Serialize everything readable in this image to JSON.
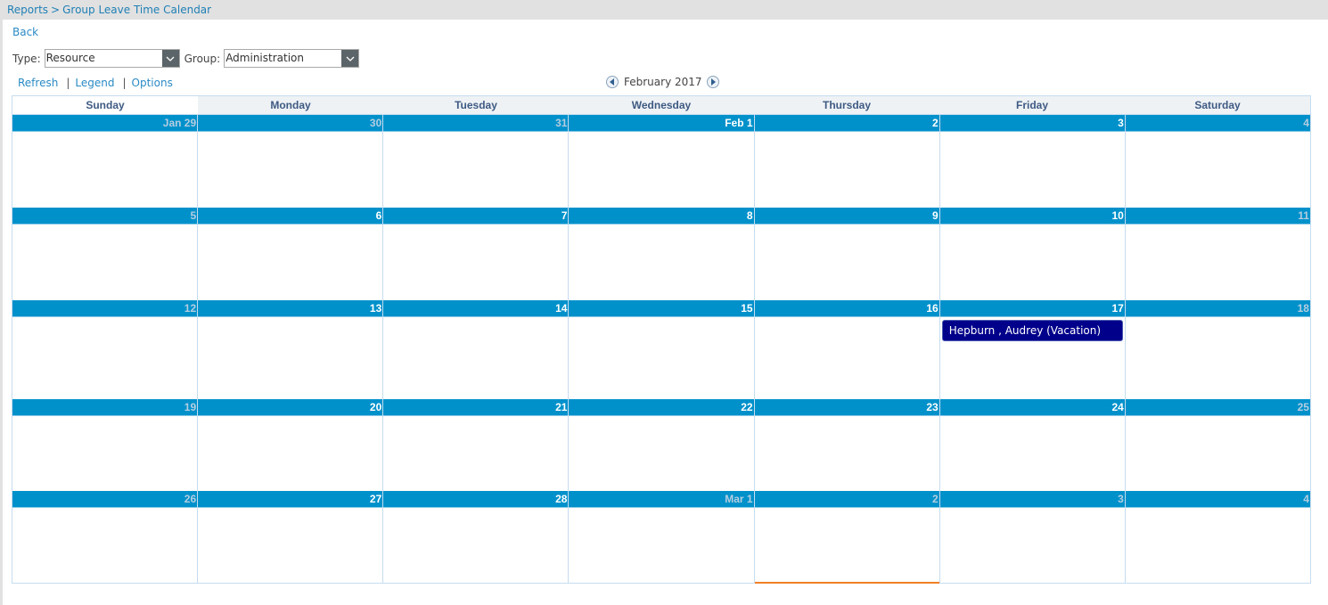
{
  "breadcrumb": {
    "parent": "Reports",
    "separator": ">",
    "current": "Group Leave Time Calendar"
  },
  "back_label": "Back",
  "filters": {
    "type_label": "Type:",
    "type_value": "Resource",
    "group_label": "Group:",
    "group_value": "Administration"
  },
  "links": {
    "refresh": "Refresh",
    "legend": "Legend",
    "options": "Options",
    "separator": "|"
  },
  "month_nav": {
    "title": "February 2017",
    "prev_icon": "chevron-left-circle-icon",
    "next_icon": "chevron-right-circle-icon"
  },
  "weekdays": [
    "Sunday",
    "Monday",
    "Tuesday",
    "Wednesday",
    "Thursday",
    "Friday",
    "Saturday"
  ],
  "colors": {
    "day_header": "#0091cb",
    "event": "#00008b",
    "today_indicator": "#f07f25",
    "link": "#2a8ac4"
  },
  "weeks": [
    {
      "days": [
        {
          "label": "Jan 29",
          "muted": true
        },
        {
          "label": "30",
          "muted": true
        },
        {
          "label": "31",
          "muted": true
        },
        {
          "label": "Feb 1",
          "muted": false
        },
        {
          "label": "2",
          "muted": false
        },
        {
          "label": "3",
          "muted": false
        },
        {
          "label": "4",
          "muted": true
        }
      ]
    },
    {
      "days": [
        {
          "label": "5",
          "muted": true
        },
        {
          "label": "6",
          "muted": false
        },
        {
          "label": "7",
          "muted": false
        },
        {
          "label": "8",
          "muted": false
        },
        {
          "label": "9",
          "muted": false
        },
        {
          "label": "10",
          "muted": false
        },
        {
          "label": "11",
          "muted": true
        }
      ]
    },
    {
      "days": [
        {
          "label": "12",
          "muted": true
        },
        {
          "label": "13",
          "muted": false
        },
        {
          "label": "14",
          "muted": false
        },
        {
          "label": "15",
          "muted": false
        },
        {
          "label": "16",
          "muted": false
        },
        {
          "label": "17",
          "muted": false,
          "event": "Hepburn , Audrey (Vacation)"
        },
        {
          "label": "18",
          "muted": true
        }
      ]
    },
    {
      "days": [
        {
          "label": "19",
          "muted": true
        },
        {
          "label": "20",
          "muted": false
        },
        {
          "label": "21",
          "muted": false
        },
        {
          "label": "22",
          "muted": false
        },
        {
          "label": "23",
          "muted": false
        },
        {
          "label": "24",
          "muted": false
        },
        {
          "label": "25",
          "muted": true
        }
      ]
    },
    {
      "days": [
        {
          "label": "26",
          "muted": true
        },
        {
          "label": "27",
          "muted": false
        },
        {
          "label": "28",
          "muted": false
        },
        {
          "label": "Mar 1",
          "muted": true
        },
        {
          "label": "2",
          "muted": true,
          "today": true
        },
        {
          "label": "3",
          "muted": true
        },
        {
          "label": "4",
          "muted": true
        }
      ]
    }
  ]
}
